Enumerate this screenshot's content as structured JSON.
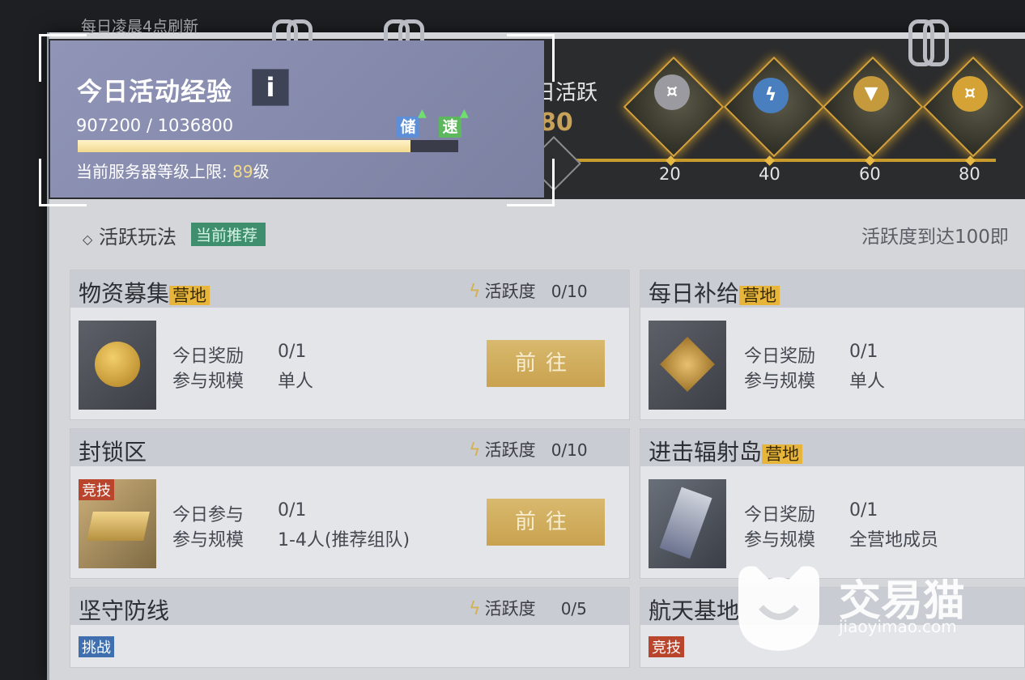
{
  "header": {
    "refresh_note": "每日凌晨4点刷新"
  },
  "exp_panel": {
    "title": "今日活动经验",
    "info_label": "i",
    "current": "907200",
    "separator": "/",
    "max": "1036800",
    "progress_fraction": 0.875,
    "boost_store": "储",
    "boost_speed": "速",
    "level_label": "当前服务器等级上限:",
    "level_value": "89",
    "level_unit": "级"
  },
  "activity": {
    "label": "今日活跃",
    "value": "80",
    "milestones": [
      "20",
      "40",
      "60",
      "80"
    ],
    "chest_icons": [
      "coin-icon",
      "lightning-icon",
      "wing-emblem-icon",
      "gold-coin-icon"
    ]
  },
  "section": {
    "title": "活跃玩法",
    "recommend_tag": "当前推荐",
    "right_note": "活跃度到达100即"
  },
  "cards": [
    {
      "title": "物资募集",
      "tag": "营地",
      "activity_label": "活跃度",
      "activity_count": "0/10",
      "row1_label": "今日奖励",
      "row1_value": "0/1",
      "row2_label": "参与规模",
      "row2_value": "单人",
      "button": "前往"
    },
    {
      "title": "每日补给",
      "tag": "营地",
      "row1_label": "今日奖励",
      "row1_value": "0/1",
      "row2_label": "参与规模",
      "row2_value": "单人"
    },
    {
      "title": "封锁区",
      "activity_label": "活跃度",
      "activity_count": "0/10",
      "mode": "竞技",
      "row1_label": "今日参与",
      "row1_value": "0/1",
      "row2_label": "参与规模",
      "row2_value": "1-4人(推荐组队)",
      "button": "前往"
    },
    {
      "title": "进击辐射岛",
      "tag": "营地",
      "row1_label": "今日奖励",
      "row1_value": "0/1",
      "row2_label": "参与规模",
      "row2_value": "全营地成员"
    },
    {
      "title": "坚守防线",
      "activity_label": "活跃度",
      "activity_count": "0/5",
      "mode": "挑战"
    },
    {
      "title": "航天基地",
      "mode": "竞技"
    }
  ],
  "watermark": {
    "name": "交易猫",
    "url": "jiaoyimao.com"
  },
  "colors": {
    "accent_gold": "#e6b53a",
    "panel_purple": "#8a8fb0",
    "track_gold": "#c89b2d",
    "recommend_green": "#3f8f6f"
  }
}
